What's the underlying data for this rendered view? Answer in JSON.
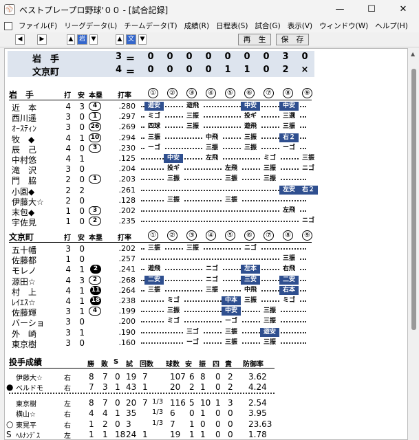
{
  "window": {
    "title": "ベストプレープロ野球'００ - [試合記録]",
    "app_icon": "baseball-app-icon"
  },
  "menu": [
    "ファイル(F)",
    "リーグデータ(L)",
    "チームデータ(T)",
    "成績(R)",
    "日程表(S)",
    "試合(G)",
    "表示(V)",
    "ウィンドウ(W)",
    "ヘルプ(H)"
  ],
  "toolbar": {
    "prev": "◀",
    "next": "▶",
    "home_prev": "▲",
    "home_label": "岩",
    "home_next": "▼",
    "away_prev": "▲",
    "away_label": "文",
    "away_next": "▼",
    "replay": "再　生",
    "save": "保　存"
  },
  "scoreboard": {
    "rows": [
      {
        "team": "岩　手",
        "total": "3",
        "eq": "＝",
        "innings": [
          "0",
          "0",
          "0",
          "0",
          "0",
          "0",
          "0",
          "3",
          "0"
        ]
      },
      {
        "team": "文京町",
        "total": "4",
        "eq": "＝",
        "innings": [
          "0",
          "0",
          "0",
          "0",
          "1",
          "1",
          "0",
          "2",
          "×"
        ]
      }
    ]
  },
  "headers": {
    "ab": "打",
    "h": "安",
    "hr": "本塁",
    "avg": "打率",
    "innings": [
      "①",
      "②",
      "③",
      "④",
      "⑤",
      "⑥",
      "⑦",
      "⑧",
      "⑨"
    ]
  },
  "iwate": {
    "team": "岩　手",
    "players": [
      {
        "name": "近　本",
        "ab": "4",
        "h": "3",
        "hr": "4",
        "hr_dark": false,
        "avg": ".280",
        "events": [
          [
            "遊安",
            1,
            true
          ],
          [
            "遊飛",
            3,
            false
          ],
          [
            "中安",
            6,
            true
          ],
          [
            "中安",
            8,
            true
          ]
        ]
      },
      {
        "name": "西川遥",
        "ab": "3",
        "h": "0",
        "hr": "1",
        "hr_dark": false,
        "avg": ".297",
        "events": [
          [
            "ミゴ",
            1,
            false
          ],
          [
            "三振",
            3,
            false
          ],
          [
            "投ギ",
            6,
            false
          ],
          [
            "三選",
            8,
            false
          ]
        ]
      },
      {
        "name": "ｵｰｽﾃｨﾝ",
        "ab": "3",
        "h": "0",
        "hr": "26",
        "hr_dark": false,
        "avg": ".269",
        "events": [
          [
            "四球",
            1,
            false
          ],
          [
            "三振",
            3,
            false
          ],
          [
            "遊飛",
            6,
            false
          ],
          [
            "三振",
            8,
            false
          ]
        ]
      },
      {
        "name": "牧　◆",
        "ab": "4",
        "h": "1",
        "hr": "10",
        "hr_dark": false,
        "avg": ".294",
        "events": [
          [
            "三振",
            1,
            false
          ],
          [
            "中飛",
            4,
            false
          ],
          [
            "三振",
            6,
            false
          ],
          [
            "右２",
            8,
            true
          ]
        ]
      },
      {
        "name": "辰　己",
        "ab": "4",
        "h": "0",
        "hr": "3",
        "hr_dark": false,
        "avg": ".230",
        "events": [
          [
            "ーゴ",
            1,
            false
          ],
          [
            "三振",
            4,
            false
          ],
          [
            "三振",
            6,
            false
          ],
          [
            "ーゴ",
            8,
            false
          ]
        ]
      },
      {
        "name": "中村悠",
        "ab": "4",
        "h": "1",
        "hr": "",
        "hr_dark": false,
        "avg": ".125",
        "events": [
          [
            "中安",
            2,
            true
          ],
          [
            "左飛",
            4,
            false
          ],
          [
            "ミゴ",
            7,
            false
          ],
          [
            "三振",
            9,
            false
          ]
        ]
      },
      {
        "name": "滝　沢",
        "ab": "3",
        "h": "0",
        "hr": "",
        "hr_dark": false,
        "avg": ".204",
        "events": [
          [
            "投ギ",
            2,
            false
          ],
          [
            "左飛",
            5,
            false
          ],
          [
            "三振",
            7,
            false
          ],
          [
            "ニゴ",
            9,
            false
          ]
        ]
      },
      {
        "name": "門　脇",
        "ab": "2",
        "h": "0",
        "hr": "1",
        "hr_dark": false,
        "avg": ".203",
        "events": [
          [
            "三振",
            2,
            false
          ],
          [
            "三振",
            5,
            false
          ],
          [
            "三振",
            7,
            false
          ]
        ]
      },
      {
        "name": "小園◆",
        "ab": "2",
        "h": "2",
        "hr": "",
        "hr_dark": false,
        "avg": ".261",
        "events": [
          [
            "左安",
            8,
            true
          ],
          [
            "右２",
            9,
            true
          ]
        ]
      },
      {
        "name": "伊藤大☆",
        "ab": "2",
        "h": "0",
        "hr": "",
        "hr_dark": false,
        "avg": ".128",
        "events": [
          [
            "三振",
            2,
            false
          ],
          [
            "三振",
            5,
            false
          ]
        ]
      },
      {
        "name": "末包◆",
        "ab": "1",
        "h": "0",
        "hr": "3",
        "hr_dark": false,
        "avg": ".202",
        "events": [
          [
            "左飛",
            8,
            false
          ]
        ]
      },
      {
        "name": "宇佐見",
        "ab": "1",
        "h": "0",
        "hr": "2",
        "hr_dark": false,
        "avg": ".235",
        "events": [
          [
            "ニゴ",
            9,
            false
          ]
        ]
      }
    ]
  },
  "bunkyo": {
    "team": "文京町",
    "players": [
      {
        "name": "五十幡",
        "ab": "3",
        "h": "0",
        "hr": "",
        "hr_dark": false,
        "avg": ".202",
        "events": [
          [
            "三振",
            1,
            false
          ],
          [
            "三振",
            3,
            false
          ],
          [
            "ニゴ",
            6,
            false
          ]
        ]
      },
      {
        "name": "佐藤都",
        "ab": "1",
        "h": "0",
        "hr": "",
        "hr_dark": false,
        "avg": ".257",
        "events": [
          [
            "三振",
            8,
            false
          ]
        ]
      },
      {
        "name": "モレノ",
        "ab": "4",
        "h": "1",
        "hr": "2",
        "hr_dark": true,
        "avg": ".241",
        "events": [
          [
            "遊飛",
            1,
            false
          ],
          [
            "ニゴ",
            4,
            false
          ],
          [
            "左本",
            6,
            true
          ],
          [
            "右飛",
            8,
            false
          ]
        ]
      },
      {
        "name": "源田☆",
        "ab": "4",
        "h": "3",
        "hr": "2",
        "hr_dark": false,
        "avg": ".268",
        "events": [
          [
            "二安",
            1,
            true
          ],
          [
            "ニゴ",
            4,
            false
          ],
          [
            "三安",
            6,
            true
          ],
          [
            "二安",
            8,
            true
          ]
        ]
      },
      {
        "name": "村　上",
        "ab": "4",
        "h": "1",
        "hr": "11",
        "hr_dark": true,
        "avg": ".264",
        "events": [
          [
            "三振",
            1,
            false
          ],
          [
            "三振",
            4,
            false
          ],
          [
            "中飛",
            6,
            false
          ],
          [
            "右本",
            8,
            true
          ]
        ]
      },
      {
        "name": "ﾚｲｴｽ☆",
        "ab": "4",
        "h": "1",
        "hr": "18",
        "hr_dark": true,
        "avg": ".238",
        "events": [
          [
            "ミゴ",
            2,
            false
          ],
          [
            "中本",
            5,
            true
          ],
          [
            "三振",
            6,
            false
          ],
          [
            "ミゴ",
            8,
            false
          ]
        ]
      },
      {
        "name": "佐藤輝",
        "ab": "3",
        "h": "1",
        "hr": "4",
        "hr_dark": false,
        "avg": ".199",
        "events": [
          [
            "三振",
            2,
            false
          ],
          [
            "中安",
            5,
            true
          ],
          [
            "三振",
            7,
            false
          ]
        ]
      },
      {
        "name": "バーショ",
        "ab": "3",
        "h": "0",
        "hr": "",
        "hr_dark": false,
        "avg": ".200",
        "events": [
          [
            "ミゴ",
            2,
            false
          ],
          [
            "ーゴ",
            5,
            false
          ],
          [
            "三振",
            7,
            false
          ]
        ]
      },
      {
        "name": "外　崎",
        "ab": "3",
        "h": "1",
        "hr": "",
        "hr_dark": false,
        "avg": ".190",
        "events": [
          [
            "三ゴ",
            3,
            false
          ],
          [
            "三振",
            5,
            false
          ],
          [
            "遊安",
            7,
            true
          ]
        ]
      },
      {
        "name": "東京樹",
        "ab": "3",
        "h": "0",
        "hr": "",
        "hr_dark": false,
        "avg": ".160",
        "events": [
          [
            "ーゴ",
            3,
            false
          ],
          [
            "三振",
            5,
            false
          ],
          [
            "三振",
            7,
            false
          ]
        ]
      }
    ]
  },
  "pitching": {
    "title": "投手成績",
    "headers": [
      "勝",
      "敗",
      "S",
      "試",
      "回数",
      "球数",
      "安",
      "振",
      "四",
      "責",
      "防御率"
    ],
    "rows": [
      {
        "mark": "",
        "name": "伊藤大☆",
        "hand": "右",
        "w": "8",
        "l": "7",
        "s": "0",
        "g": "19",
        "ip": "7",
        "ipf": "",
        "pitches": "107",
        "h": "6",
        "k": "8",
        "bb": "0",
        "er": "2",
        "era": "3.62"
      },
      {
        "mark": "●",
        "name": "ベルドモ",
        "hand": "右",
        "w": "7",
        "l": "3",
        "s": "1",
        "g": "43",
        "ip": "1",
        "ipf": "",
        "pitches": "20",
        "h": "2",
        "k": "1",
        "bb": "0",
        "er": "2",
        "era": "4.24"
      },
      {
        "mark": "",
        "name": "東京樹",
        "hand": "左",
        "w": "8",
        "l": "7",
        "s": "0",
        "g": "20",
        "ip": "7",
        "ipf": "1/3",
        "pitches": "116",
        "h": "5",
        "k": "10",
        "bb": "1",
        "er": "3",
        "era": "2.54"
      },
      {
        "mark": "",
        "name": "横山☆",
        "hand": "右",
        "w": "4",
        "l": "4",
        "s": "1",
        "g": "35",
        "ip": "",
        "ipf": "1/3",
        "pitches": "6",
        "h": "0",
        "k": "1",
        "bb": "0",
        "er": "0",
        "era": "3.95"
      },
      {
        "mark": "○",
        "name": "東晃平",
        "hand": "右",
        "w": "1",
        "l": "2",
        "s": "0",
        "g": "3",
        "ip": "",
        "ipf": "1/3",
        "pitches": "7",
        "h": "1",
        "k": "0",
        "bb": "0",
        "er": "0",
        "era": "23.63"
      },
      {
        "mark": "S",
        "name": "ﾍﾙﾅﾝﾃﾞｽ",
        "hand": "左",
        "w": "1",
        "l": "1",
        "s": "18",
        "g": "24",
        "ip": "1",
        "ipf": "",
        "pitches": "19",
        "h": "1",
        "k": "1",
        "bb": "0",
        "er": "0",
        "era": "1.78"
      }
    ]
  }
}
